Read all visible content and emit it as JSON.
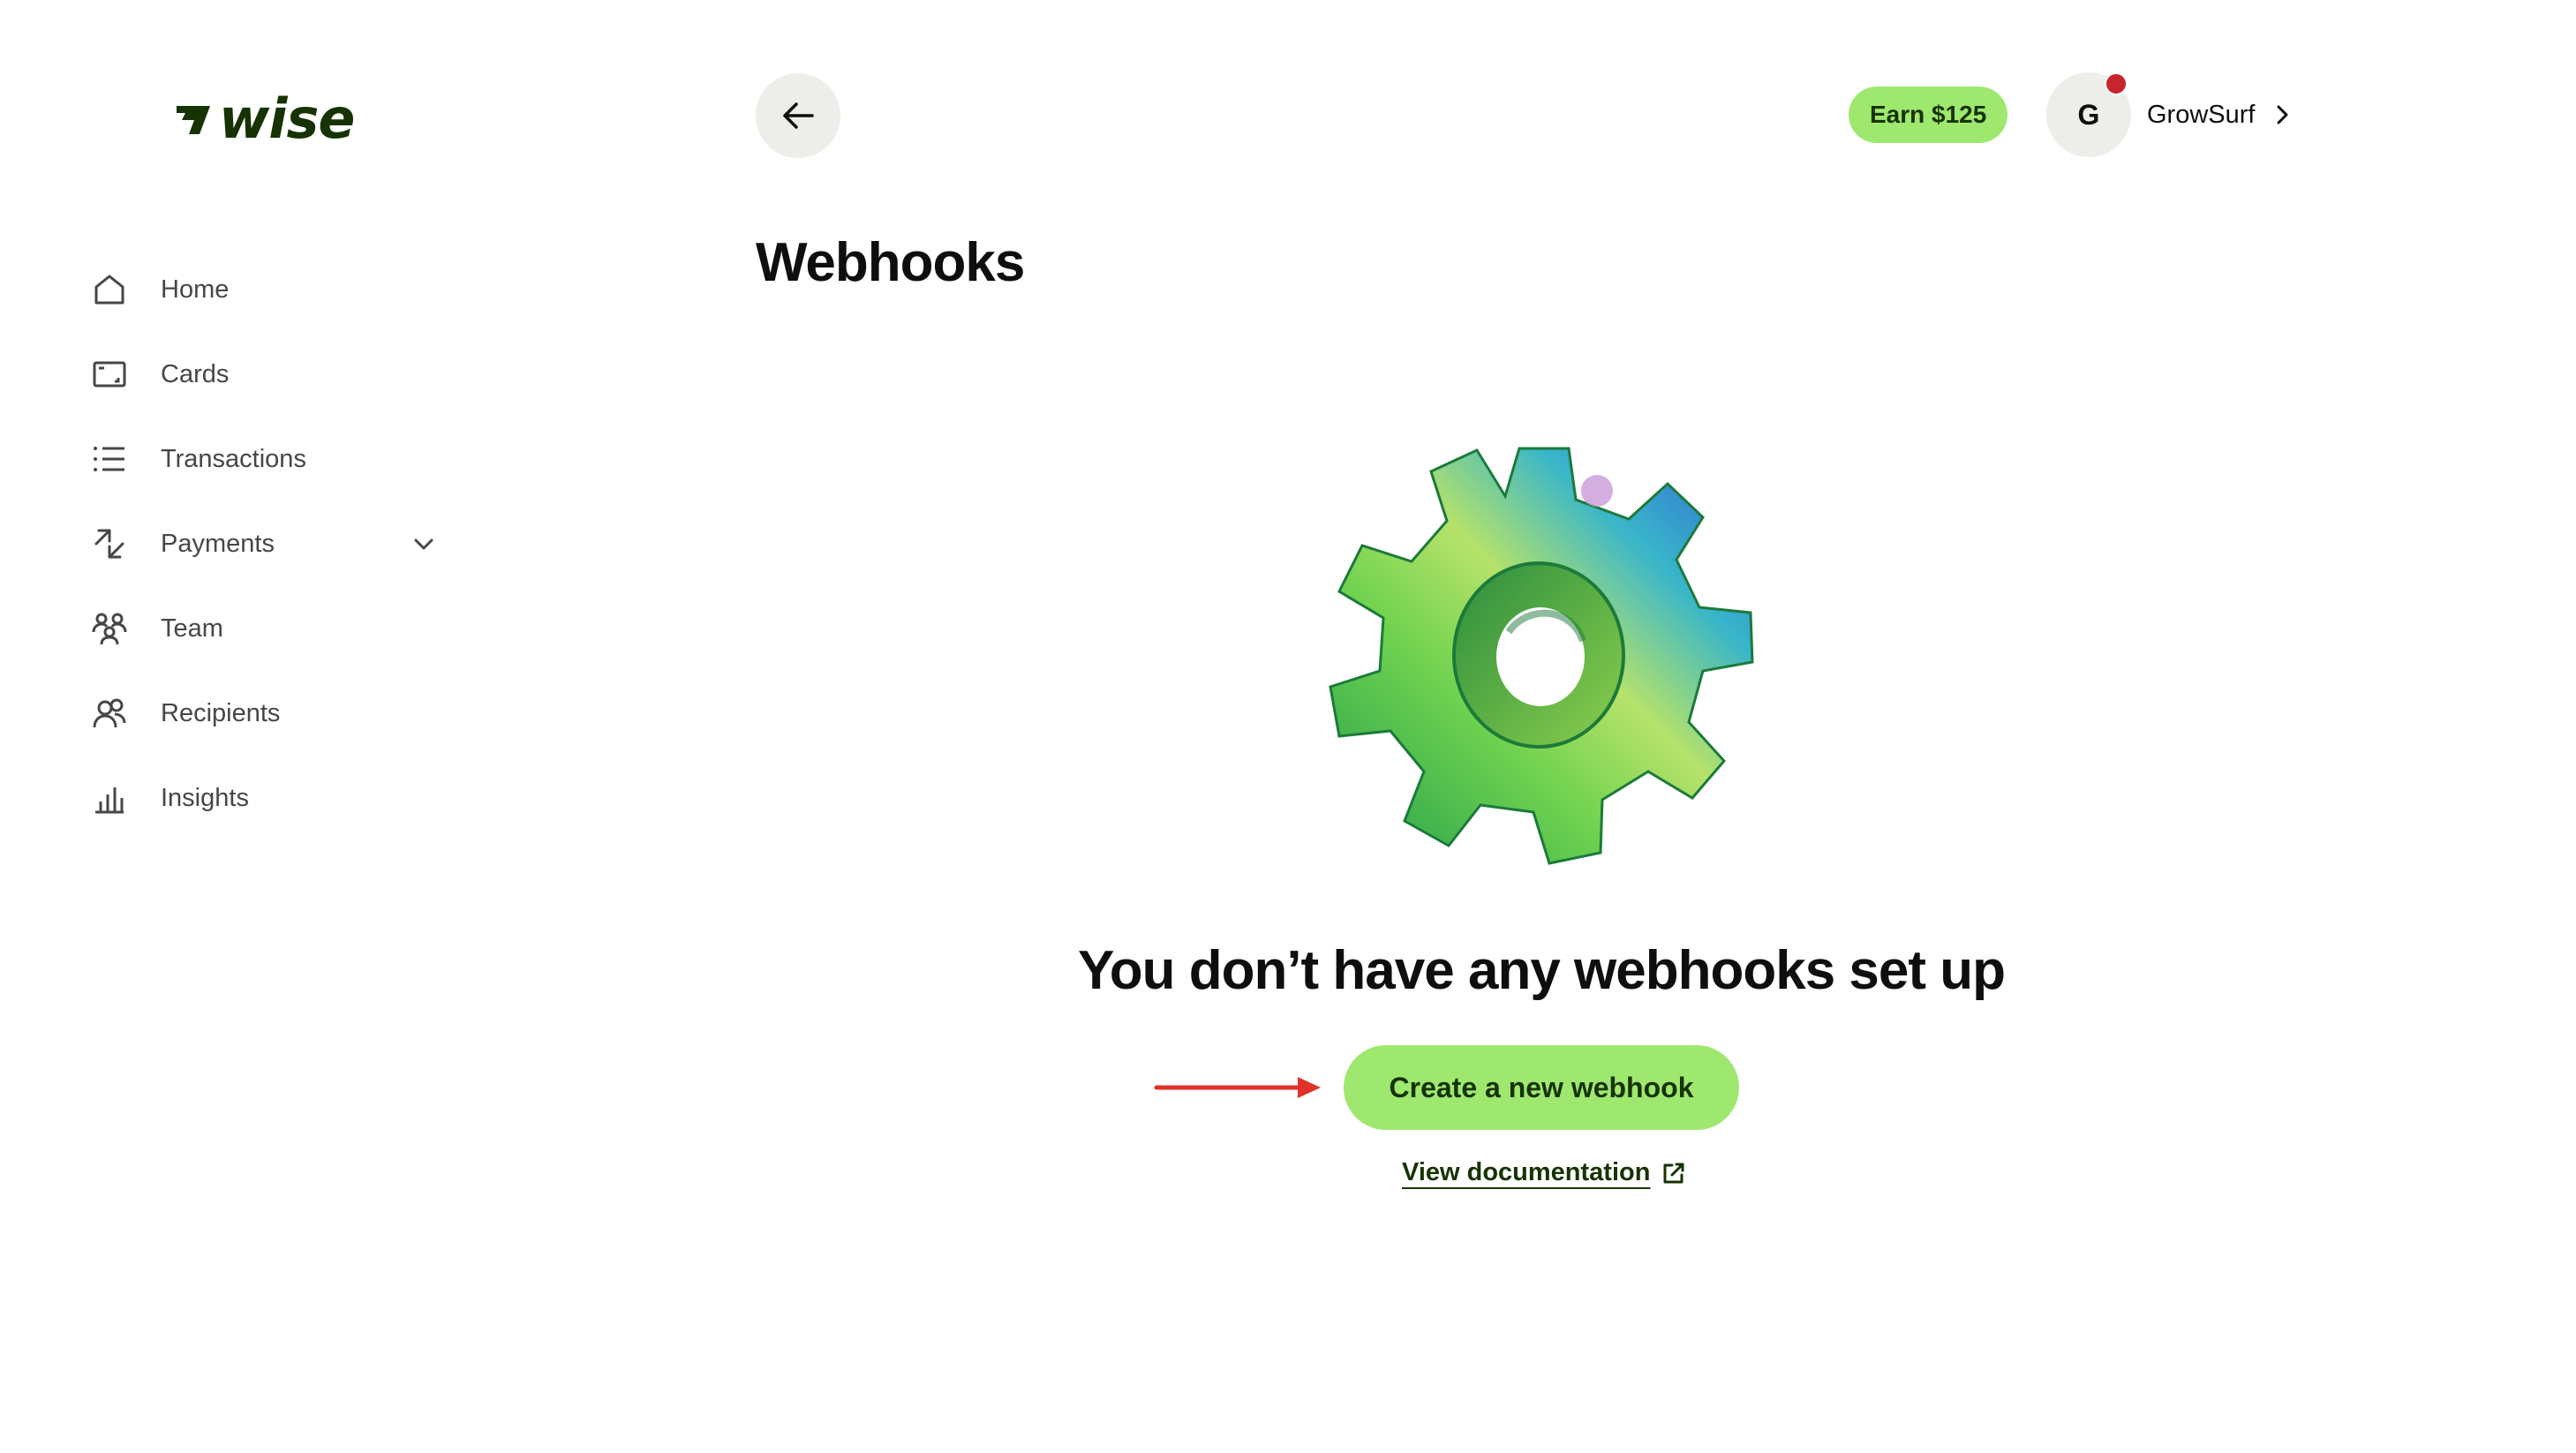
{
  "brand": {
    "logo_text": "wise",
    "color": "#163300"
  },
  "sidebar": {
    "items": [
      {
        "label": "Home",
        "icon": "home-icon"
      },
      {
        "label": "Cards",
        "icon": "card-icon"
      },
      {
        "label": "Transactions",
        "icon": "list-icon"
      },
      {
        "label": "Payments",
        "icon": "payments-arrows-icon",
        "expandable": true
      },
      {
        "label": "Team",
        "icon": "team-icon"
      },
      {
        "label": "Recipients",
        "icon": "recipients-icon"
      },
      {
        "label": "Insights",
        "icon": "bar-chart-icon"
      }
    ]
  },
  "header": {
    "back_icon": "arrow-left-icon",
    "earn_label": "Earn $125",
    "account": {
      "initial": "G",
      "name": "GrowSurf",
      "has_notification": true
    }
  },
  "main": {
    "title": "Webhooks",
    "empty_state": {
      "illustration": "gear-illustration",
      "heading": "You don’t have any webhooks set up",
      "create_label": "Create a new webhook",
      "docs_label": "View documentation",
      "docs_icon": "external-link-icon"
    }
  },
  "colors": {
    "accent": "#9fe870",
    "accent_text": "#163300",
    "notification": "#c8242b",
    "annotation_arrow": "#e0312b",
    "surface": "#ededea"
  }
}
